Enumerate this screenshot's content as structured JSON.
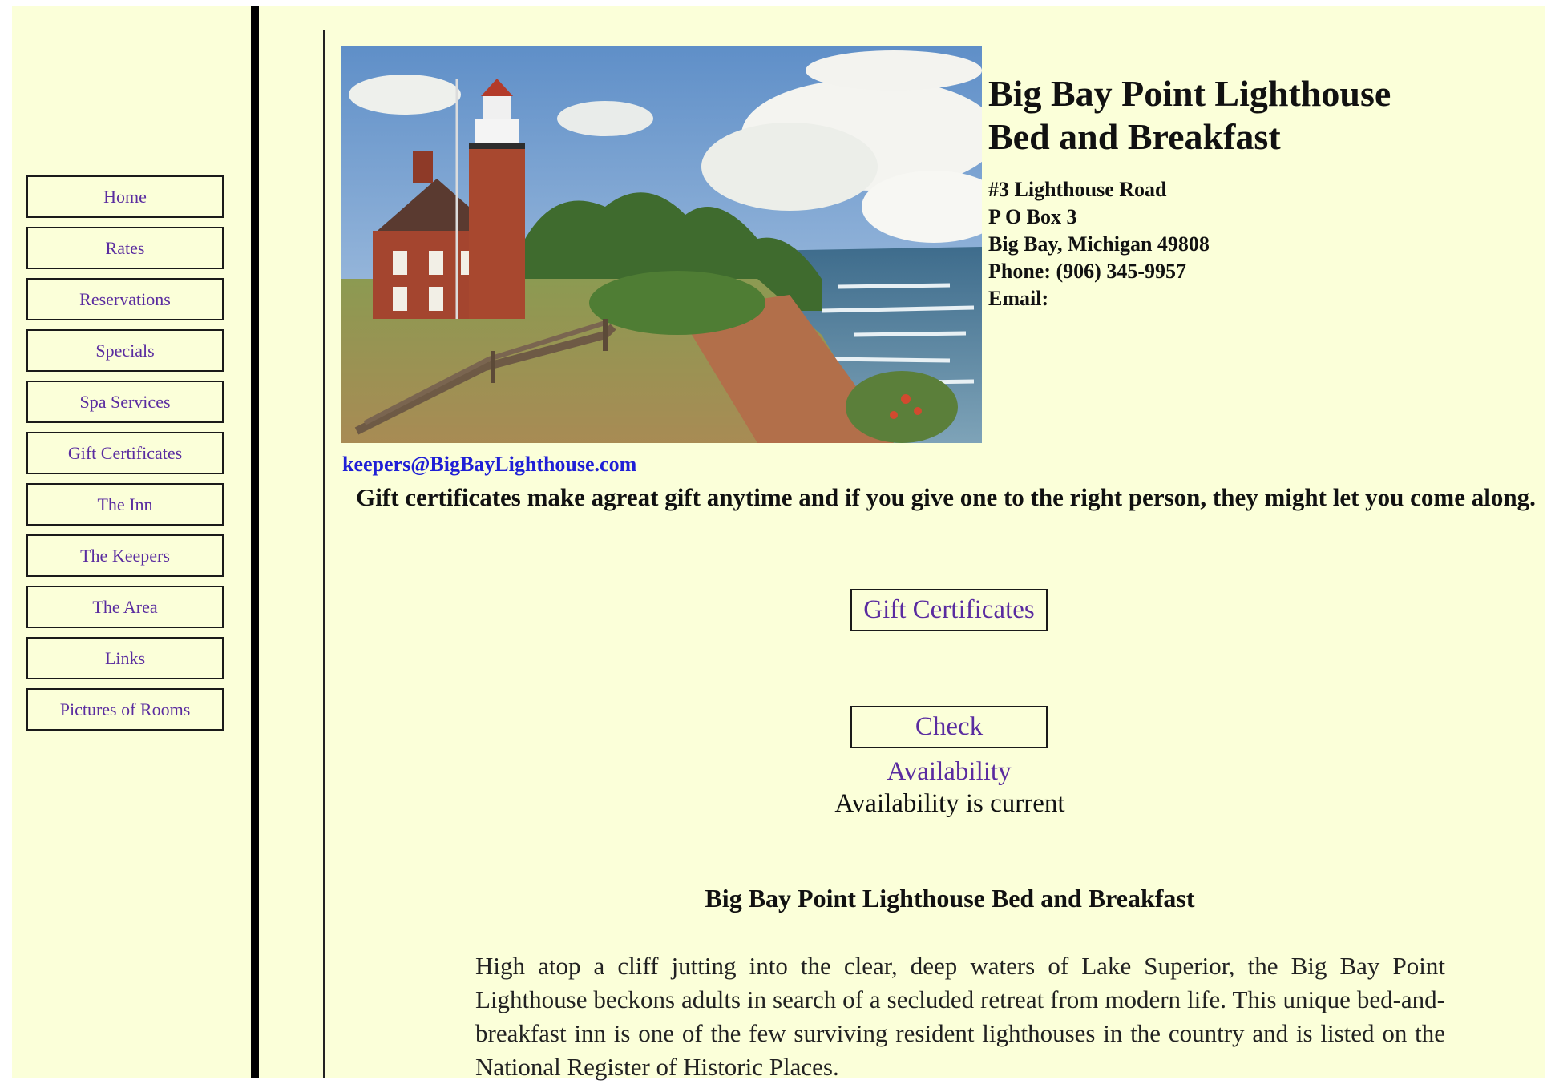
{
  "nav": {
    "items": [
      {
        "label": "Home"
      },
      {
        "label": "Rates"
      },
      {
        "label": "Reservations"
      },
      {
        "label": "Specials"
      },
      {
        "label": "Spa Services"
      },
      {
        "label": "Gift Certificates"
      },
      {
        "label": "The Inn"
      },
      {
        "label": "The Keepers"
      },
      {
        "label": "The Area"
      },
      {
        "label": "Links"
      },
      {
        "label": "Pictures of Rooms"
      }
    ]
  },
  "header": {
    "title_line1": "Big Bay Point Lighthouse",
    "title_line2": "Bed and Breakfast",
    "address": {
      "street": "#3 Lighthouse Road",
      "po_box": "P O Box 3",
      "city": "Big Bay, Michigan 49808",
      "phone": "Phone: (906) 345-9957",
      "email_label": "Email:"
    },
    "email": "keepers@BigBayLighthouse.com"
  },
  "main": {
    "promo": "Gift certificates make agreat gift anytime and if you give one to the right person, they might let you come along.",
    "gift_button": "Gift Certificates",
    "check_button": "Check",
    "availability_link": "Availability",
    "availability_status": "Availability is current",
    "section_heading": "Big Bay Point Lighthouse Bed and Breakfast",
    "intro": "High atop a cliff jutting into the clear, deep waters of Lake Superior, the Big Bay Point Lighthouse beckons adults in search of a secluded retreat from modern life. This unique bed-and-breakfast inn is one of the few surviving resident lighthouses in the country and is listed on the National Register of Historic Places."
  },
  "colors": {
    "page_background": "#fbffd9",
    "nav_text": "#5a2ca0",
    "email_link": "#1f1fd6"
  }
}
